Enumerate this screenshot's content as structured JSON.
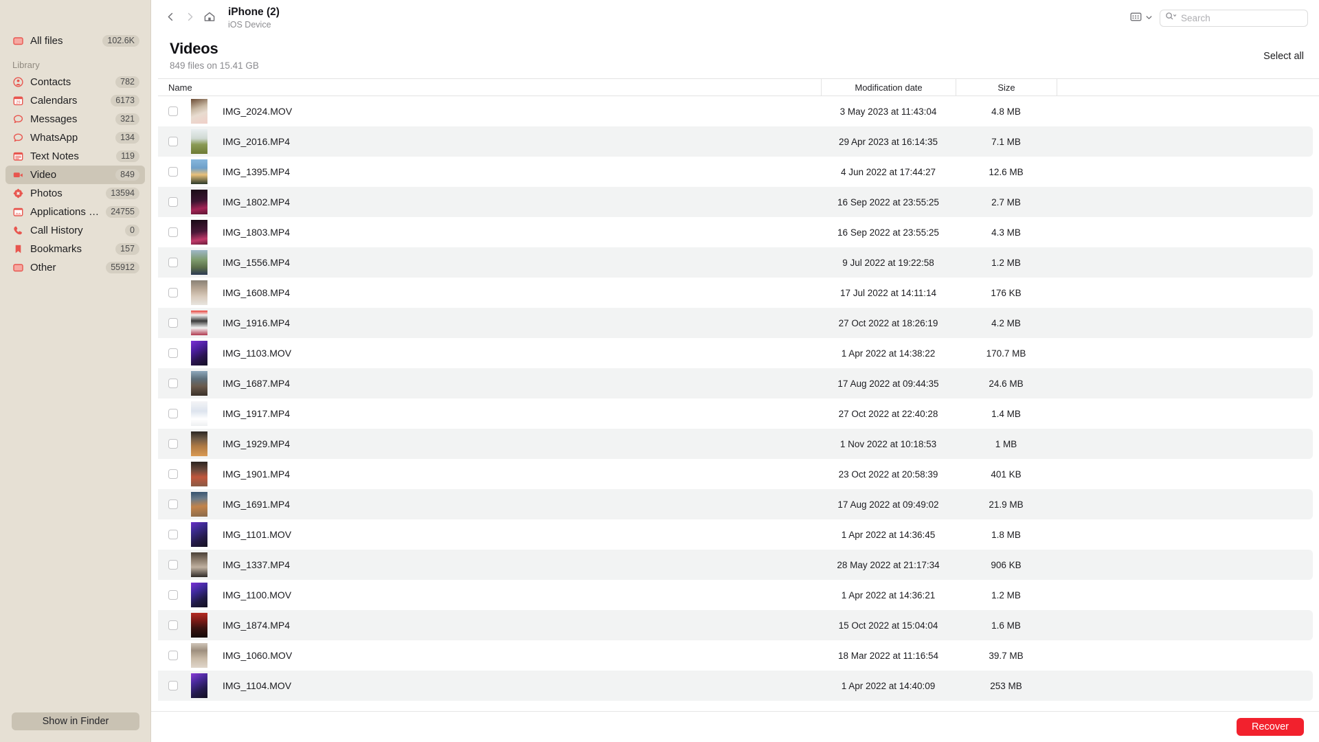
{
  "sidebar": {
    "all_files": {
      "label": "All files",
      "count": "102.6K",
      "icon": "folder-icon"
    },
    "section_label": "Library",
    "items": [
      {
        "label": "Contacts",
        "count": "782",
        "icon": "contacts-icon"
      },
      {
        "label": "Calendars",
        "count": "6173",
        "icon": "calendar-icon"
      },
      {
        "label": "Messages",
        "count": "321",
        "icon": "message-bubble-icon"
      },
      {
        "label": "WhatsApp",
        "count": "134",
        "icon": "message-bubble-icon"
      },
      {
        "label": "Text Notes",
        "count": "119",
        "icon": "notes-icon"
      },
      {
        "label": "Video",
        "count": "849",
        "icon": "video-camera-icon",
        "active": true
      },
      {
        "label": "Photos",
        "count": "13594",
        "icon": "photos-flower-icon"
      },
      {
        "label": "Applications photo",
        "count": "24755",
        "icon": "app-photo-icon"
      },
      {
        "label": "Call History",
        "count": "0",
        "icon": "phone-icon"
      },
      {
        "label": "Bookmarks",
        "count": "157",
        "icon": "bookmark-icon"
      },
      {
        "label": "Other",
        "count": "55912",
        "icon": "folder-icon"
      }
    ],
    "show_in_finder": "Show in Finder"
  },
  "toolbar": {
    "back_icon": "chevron-left-icon",
    "forward_icon": "chevron-right-icon",
    "home_icon": "home-icon",
    "device_title": "iPhone (2)",
    "device_subtitle": "iOS Device",
    "view_icon": "grid-view-icon",
    "view_chevron_icon": "chevron-down-icon",
    "search_icon": "search-icon",
    "search_value": "",
    "search_placeholder": "Search"
  },
  "page": {
    "title": "Videos",
    "subtitle": "849 files on 15.41 GB",
    "select_all": "Select all"
  },
  "table": {
    "columns": [
      "Name",
      "Modification date",
      "Size"
    ],
    "rows": [
      {
        "name": "IMG_2024.MOV",
        "date": "3 May 2023 at 11:43:04",
        "size": "4.8 MB",
        "thumb": "linear-gradient(160deg,#6b4b34 0%,#c9b9a4 38%,#e8dcd0 60%,#f0cfc8 100%)"
      },
      {
        "name": "IMG_2016.MP4",
        "date": "29 Apr 2023 at 16:14:35",
        "size": "7.1 MB",
        "thumb": "linear-gradient(180deg,#e9eef0 0%,#cfd9d2 38%,#8a9a55 62%,#6d7a34 100%)"
      },
      {
        "name": "IMG_1395.MP4",
        "date": "4 Jun 2022 at 17:44:27",
        "size": "12.6 MB",
        "thumb": "linear-gradient(180deg,#87b7dd 0%,#6fa0c9 35%,#e8c07a 62%,#2c3a2a 100%)"
      },
      {
        "name": "IMG_1802.MP4",
        "date": "16 Sep 2022 at 23:55:25",
        "size": "2.7 MB",
        "thumb": "linear-gradient(170deg,#1a0d16 0%,#3a1430 45%,#a32456 75%,#5c1330 100%)"
      },
      {
        "name": "IMG_1803.MP4",
        "date": "16 Sep 2022 at 23:55:25",
        "size": "4.3 MB",
        "thumb": "linear-gradient(170deg,#170a14 0%,#4a1838 48%,#c03a6a 78%,#6a1a38 100%)"
      },
      {
        "name": "IMG_1556.MP4",
        "date": "9 Jul 2022 at 19:22:58",
        "size": "1.2 MB",
        "thumb": "linear-gradient(180deg,#9fb7c8 0%,#7d9a6c 40%,#5c6f4a 70%,#2c3a52 100%)"
      },
      {
        "name": "IMG_1608.MP4",
        "date": "17 Jul 2022 at 14:11:14",
        "size": "176 KB",
        "thumb": "linear-gradient(180deg,#8a8276 0%,#b9a795 35%,#d8cabb 65%,#e8e4de 100%)"
      },
      {
        "name": "IMG_1916.MP4",
        "date": "27 Oct 2022 at 18:26:19",
        "size": "4.2 MB",
        "thumb": "linear-gradient(180deg,#e8423c 0%,#f2f2f2 18%,#3a3a3a 42%,#f4f4f4 70%,#b03a50 100%)"
      },
      {
        "name": "IMG_1103.MOV",
        "date": "1 Apr 2022 at 14:38:22",
        "size": "170.7 MB",
        "thumb": "linear-gradient(150deg,#7b2fd6 0%,#4a1e9c 35%,#2a1450 65%,#141024 100%)"
      },
      {
        "name": "IMG_1687.MP4",
        "date": "17 Aug 2022 at 09:44:35",
        "size": "24.6 MB",
        "thumb": "linear-gradient(180deg,#8ea8bc 0%,#5d6f7a 32%,#6a5a4c 62%,#3a3028 100%)"
      },
      {
        "name": "IMG_1917.MP4",
        "date": "27 Oct 2022 at 22:40:28",
        "size": "1.4 MB",
        "thumb": "linear-gradient(180deg,#f4f4f6 0%,#dde4ee 40%,#ffffff 72%,#eef0f2 100%)"
      },
      {
        "name": "IMG_1929.MP4",
        "date": "1 Nov 2022 at 10:18:53",
        "size": "1 MB",
        "thumb": "linear-gradient(180deg,#2b2622 0%,#6f5a46 30%,#b07a44 60%,#d99a52 100%)"
      },
      {
        "name": "IMG_1901.MP4",
        "date": "23 Oct 2022 at 20:58:39",
        "size": "401 KB",
        "thumb": "linear-gradient(180deg,#2a2420 0%,#6e4a3c 35%,#c0563c 62%,#8a5a44 100%)"
      },
      {
        "name": "IMG_1691.MP4",
        "date": "17 Aug 2022 at 09:49:02",
        "size": "21.9 MB",
        "thumb": "linear-gradient(175deg,#32506e 0%,#6a7a88 28%,#c2834a 58%,#8a6a4a 100%)"
      },
      {
        "name": "IMG_1101.MOV",
        "date": "1 Apr 2022 at 14:36:45",
        "size": "1.8 MB",
        "thumb": "linear-gradient(150deg,#6a2ec8 0%,#3a2a8c 32%,#241a48 66%,#15121f 100%)"
      },
      {
        "name": "IMG_1337.MP4",
        "date": "28 May 2022 at 21:17:34",
        "size": "906 KB",
        "thumb": "linear-gradient(180deg,#4a4038 0%,#8a7a6a 30%,#bfb0a0 60%,#2e2a26 100%)"
      },
      {
        "name": "IMG_1100.MOV",
        "date": "1 Apr 2022 at 14:36:21",
        "size": "1.2 MB",
        "thumb": "linear-gradient(150deg,#7b2fd6 0%,#3e2a9c 34%,#1f1a44 68%,#120f20 100%)"
      },
      {
        "name": "IMG_1874.MP4",
        "date": "15 Oct 2022 at 15:04:04",
        "size": "1.6 MB",
        "thumb": "linear-gradient(180deg,#b42a22 0%,#7a1a16 32%,#3a1210 62%,#140a08 100%)"
      },
      {
        "name": "IMG_1060.MOV",
        "date": "18 Mar 2022 at 11:16:54",
        "size": "39.7 MB",
        "thumb": "linear-gradient(180deg,#cfc5b8 0%,#9e8f7e 30%,#c8b9a6 62%,#e0d6ca 100%)"
      },
      {
        "name": "IMG_1104.MOV",
        "date": "1 Apr 2022 at 14:40:09",
        "size": "253 MB",
        "thumb": "linear-gradient(150deg,#8a3ad6 0%,#4a2a9c 32%,#241a4e 66%,#120f20 100%)"
      }
    ]
  },
  "footer": {
    "recover": "Recover"
  },
  "colors": {
    "sidebar_bg": "#e6e0d4",
    "sidebar_active": "#cdc6b7",
    "icon_red": "#e8564f",
    "recover_red": "#f2212d",
    "row_alt": "#f2f3f3"
  }
}
